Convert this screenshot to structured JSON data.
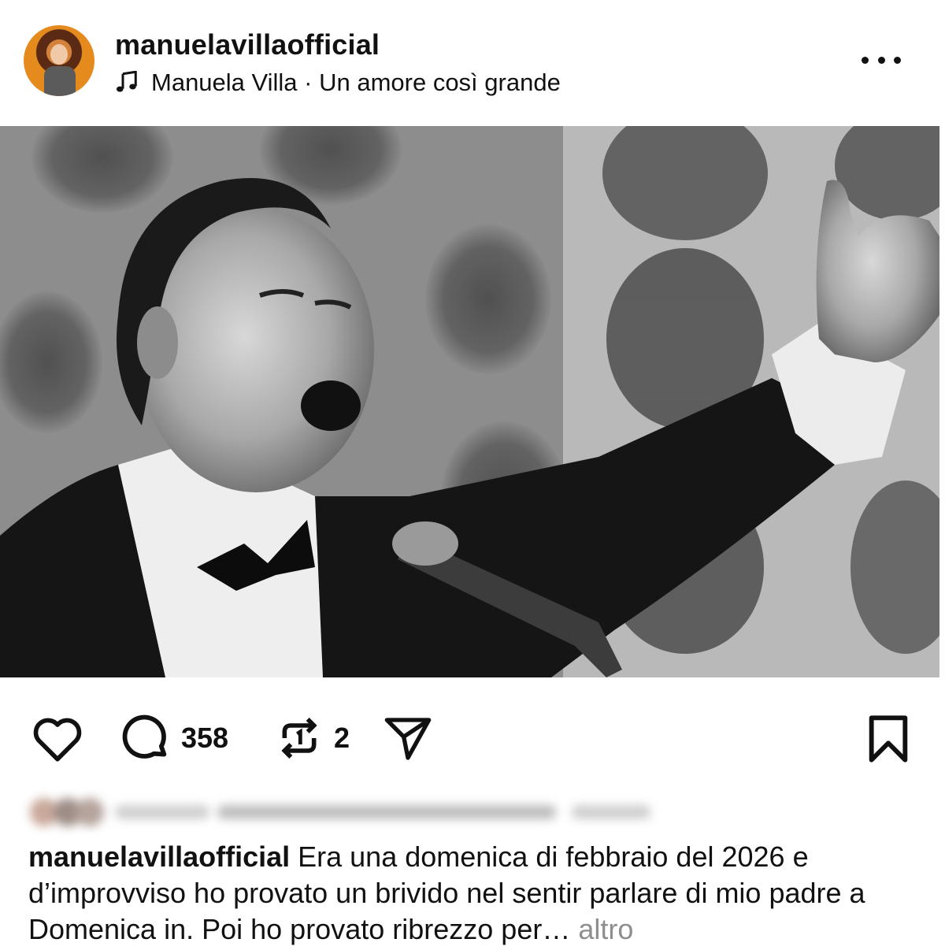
{
  "post": {
    "username": "manuelavillaofficial",
    "audio": "Manuela Villa · Un amore così grande"
  },
  "actions": {
    "comment_count": "358",
    "repost_count": "2"
  },
  "caption": {
    "username": "manuelavillaofficial",
    "text": " Era una domenica di febbraio del 2026 e d’improvviso ho provato un brivido nel sentir parlare di mio padre a Domenica in.  Poi  ho provato ribrezzo per…",
    "more": " altro"
  },
  "icons": {
    "like": "heart-icon",
    "comment": "comment-icon",
    "repost": "repost-icon",
    "share": "send-icon",
    "save": "bookmark-icon",
    "audio": "music-note-icon",
    "mute": "speaker-muted-icon",
    "menu": "more-horizontal-icon"
  }
}
